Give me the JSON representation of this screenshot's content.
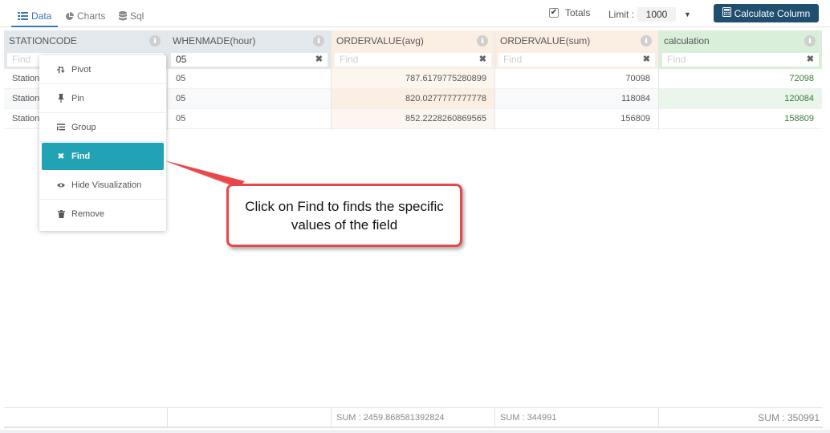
{
  "tabs": [
    {
      "label": "Data",
      "icon": "grid-icon",
      "active": true
    },
    {
      "label": "Charts",
      "icon": "pie-chart-icon",
      "active": false
    },
    {
      "label": "Sql",
      "icon": "database-icon",
      "active": false
    }
  ],
  "toolbar": {
    "totals_label": "Totals",
    "totals_checked": true,
    "limit_label": "Limit :",
    "limit_value": "1000",
    "calc_button": "Calculate Column"
  },
  "columns": [
    {
      "header": "STATIONCODE",
      "filter_value": "",
      "filter_placeholder": "Find",
      "rows": [
        "Station",
        "Station",
        "Station"
      ],
      "footer": ""
    },
    {
      "header": "WHENMADE(hour)",
      "filter_value": "05",
      "filter_placeholder": "",
      "rows": [
        "05",
        "05",
        "05"
      ],
      "footer": ""
    },
    {
      "header": "ORDERVALUE(avg)",
      "filter_value": "",
      "filter_placeholder": "Find",
      "rows": [
        "787.6179775280899",
        "820.0277777777778",
        "852.2228260869565"
      ],
      "footer": "SUM : 2459.868581392824"
    },
    {
      "header": "ORDERVALUE(sum)",
      "filter_value": "",
      "filter_placeholder": "Find",
      "rows": [
        "70098",
        "118084",
        "156809"
      ],
      "footer": "SUM : 344991"
    },
    {
      "header": "calculation",
      "filter_value": "",
      "filter_placeholder": "Find",
      "rows": [
        "72098",
        "120084",
        "158809"
      ],
      "footer": "SUM : 350991"
    }
  ],
  "context_menu": {
    "items": [
      {
        "label": "Pivot",
        "icon": "pivot-icon"
      },
      {
        "label": "Pin",
        "icon": "pin-icon"
      },
      {
        "label": "Group",
        "icon": "group-list-icon"
      },
      {
        "label": "Find",
        "icon": "close-x-icon",
        "active": true
      },
      {
        "label": "Hide Visualization",
        "icon": "eye-icon"
      },
      {
        "label": "Remove",
        "icon": "trash-icon"
      }
    ]
  },
  "callout": {
    "text": "Click on Find to finds the specific values of the field"
  },
  "colors": {
    "accent": "#3a77b8",
    "calc_button": "#1f4e6f",
    "menu_active": "#21a2b5",
    "callout_border": "#e8474a"
  }
}
